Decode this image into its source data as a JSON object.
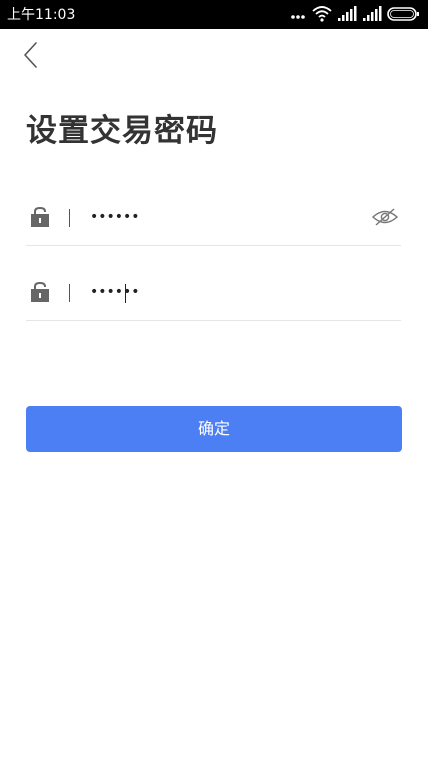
{
  "status_bar": {
    "time": "上午11:03",
    "icons": [
      "more-dots-icon",
      "wifi-icon",
      "signal-icon",
      "signal-icon",
      "battery-icon"
    ]
  },
  "nav": {
    "back_icon": "chevron-left-icon"
  },
  "page": {
    "title": "设置交易密码"
  },
  "fields": [
    {
      "icon": "lock-icon",
      "value": "123456",
      "toggle_icon": "eye-hidden-icon"
    },
    {
      "icon": "lock-icon",
      "value": "123456"
    }
  ],
  "actions": {
    "confirm_label": "确定"
  },
  "colors": {
    "accent": "#4d7ff4",
    "title_text": "#333333",
    "icon_gray": "#666666",
    "divider": "#e6e6e6",
    "status_bar_bg": "#000000"
  }
}
